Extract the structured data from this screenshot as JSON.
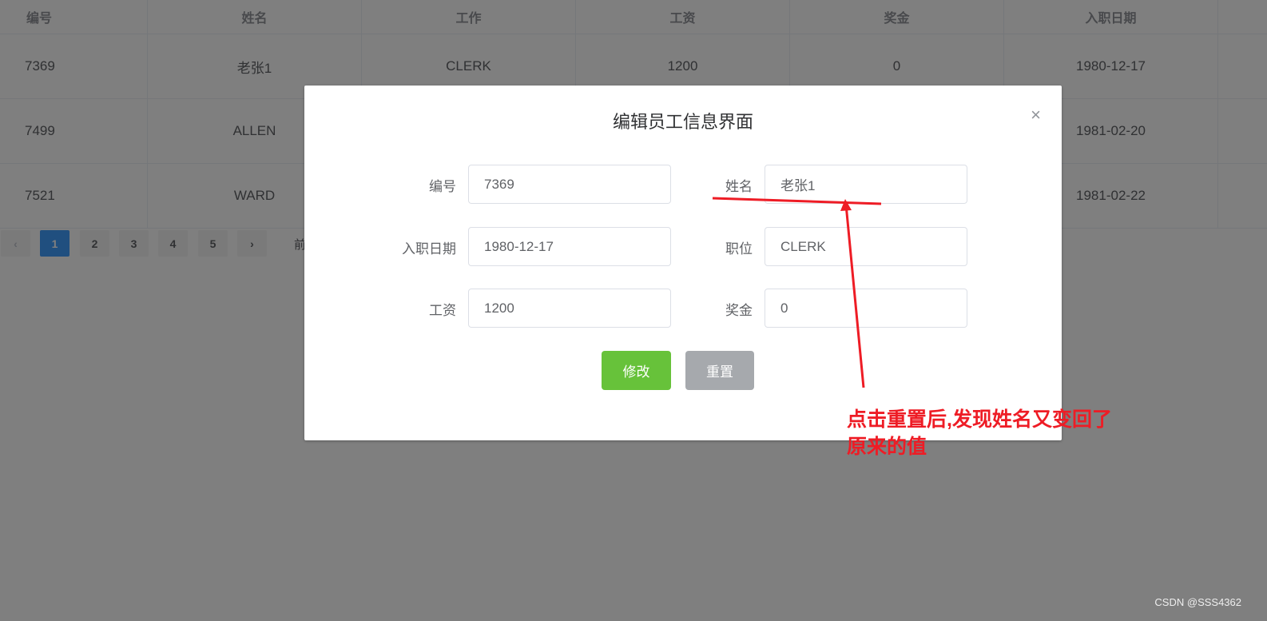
{
  "table": {
    "headers": [
      "编号",
      "姓名",
      "工作",
      "工资",
      "奖金",
      "入职日期"
    ],
    "rows": [
      [
        "7369",
        "老张1",
        "CLERK",
        "1200",
        "0",
        "1980-12-17"
      ],
      [
        "7499",
        "ALLEN",
        "",
        "",
        "",
        "1981-02-20"
      ],
      [
        "7521",
        "WARD",
        "",
        "",
        "",
        "1981-02-22"
      ]
    ]
  },
  "pagination": {
    "prev": "‹",
    "pages": [
      "1",
      "2",
      "3",
      "4",
      "5"
    ],
    "next": "›",
    "active": "1",
    "trailing_text": "前"
  },
  "dialog": {
    "title": "编辑员工信息界面",
    "close": "×",
    "fields": [
      {
        "label": "编号",
        "value": "7369"
      },
      {
        "label": "姓名",
        "value": "老张1"
      },
      {
        "label": "入职日期",
        "value": "1980-12-17"
      },
      {
        "label": "职位",
        "value": "CLERK"
      },
      {
        "label": "工资",
        "value": "1200"
      },
      {
        "label": "奖金",
        "value": "0"
      }
    ],
    "submit_label": "修改",
    "reset_label": "重置",
    "colors": {
      "submit": "#67c23a",
      "reset": "#a6a9ad"
    }
  },
  "annotation": {
    "line1": "点击重置后,发现姓名又变回了",
    "line2": "原来的值",
    "color": "#ee1c25"
  },
  "watermark": "CSDN @SSS4362"
}
